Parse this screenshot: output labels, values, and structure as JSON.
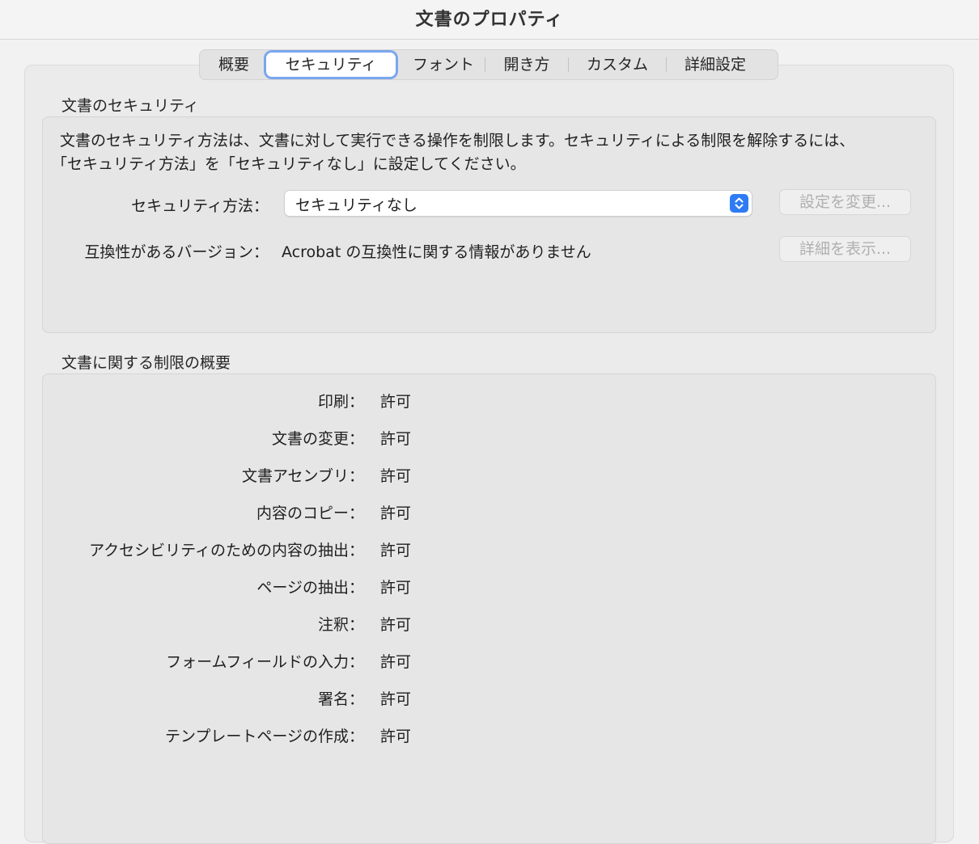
{
  "window": {
    "title": "文書のプロパティ"
  },
  "tabs": [
    {
      "label": "概要",
      "selected": false
    },
    {
      "label": "セキュリティ",
      "selected": true
    },
    {
      "label": "フォント",
      "selected": false
    },
    {
      "label": "開き方",
      "selected": false
    },
    {
      "label": "カスタム",
      "selected": false
    },
    {
      "label": "詳細設定",
      "selected": false
    }
  ],
  "security": {
    "section_title": "文書のセキュリティ",
    "description_line1": "文書のセキュリティ方法は、文書に対して実行できる操作を制限します。セキュリティによる制限を解除するには、",
    "description_line2": "「セキュリティ方法」を「セキュリティなし」に設定してください。",
    "method_label": "セキュリティ方法：",
    "method_value": "セキュリティなし",
    "change_settings_label": "設定を変更...",
    "compat_label": "互換性があるバージョン：",
    "compat_value": "Acrobat の互換性に関する情報がありません",
    "show_details_label": "詳細を表示...",
    "accent_color": "#2f7bf5"
  },
  "restrictions": {
    "section_title": "文書に関する制限の概要",
    "rows": [
      {
        "label": "印刷：",
        "value": "許可"
      },
      {
        "label": "文書の変更：",
        "value": "許可"
      },
      {
        "label": "文書アセンブリ：",
        "value": "許可"
      },
      {
        "label": "内容のコピー：",
        "value": "許可"
      },
      {
        "label": "アクセシビリティのための内容の抽出：",
        "value": "許可"
      },
      {
        "label": "ページの抽出：",
        "value": "許可"
      },
      {
        "label": "注釈：",
        "value": "許可"
      },
      {
        "label": "フォームフィールドの入力：",
        "value": "許可"
      },
      {
        "label": "署名：",
        "value": "許可"
      },
      {
        "label": "テンプレートページの作成：",
        "value": "許可"
      }
    ]
  }
}
